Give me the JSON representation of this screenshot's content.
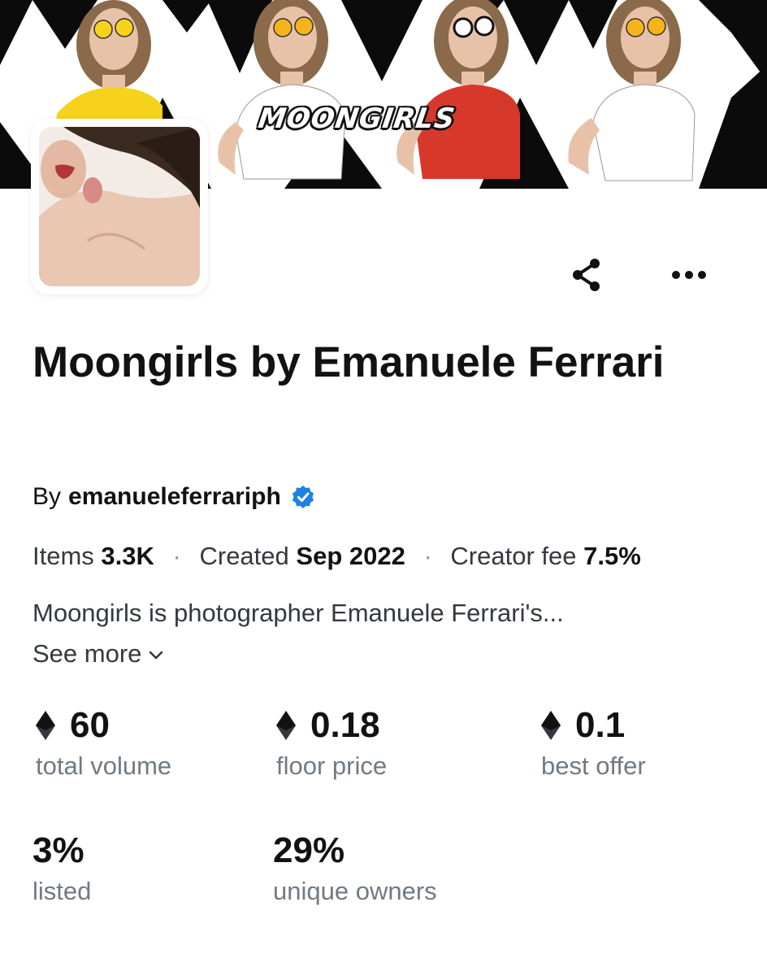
{
  "banner": {
    "logo_text": "MOONGIRLS",
    "shirt_colors": [
      "#f6d21a",
      "#ffffff",
      "#d6392b",
      "#ffffff"
    ]
  },
  "collection": {
    "title": "Moongirls by Emanuele Ferrari",
    "by_label": "By",
    "creator": "emanueleferrariph",
    "verified": true,
    "items_label": "Items",
    "items_value": "3.3K",
    "created_label": "Created",
    "created_value": "Sep 2022",
    "fee_label": "Creator fee",
    "fee_value": "7.5%",
    "separator": "·",
    "description": "Moongirls is photographer Emanuele Ferrari's...",
    "see_more": "See more"
  },
  "stats": [
    {
      "value": "60",
      "label": "total volume",
      "eth": true
    },
    {
      "value": "0.18",
      "label": "floor price",
      "eth": true
    },
    {
      "value": "0.1",
      "label": "best offer",
      "eth": true
    },
    {
      "value": "3%",
      "label": "listed",
      "eth": false
    },
    {
      "value": "29%",
      "label": "unique owners",
      "eth": false
    }
  ],
  "actions": {
    "share_icon": "share-icon",
    "more_icon": "more-horizontal-icon"
  },
  "colors": {
    "text_primary": "#121212",
    "text_secondary": "#707a83",
    "verified_blue": "#2081e2"
  }
}
